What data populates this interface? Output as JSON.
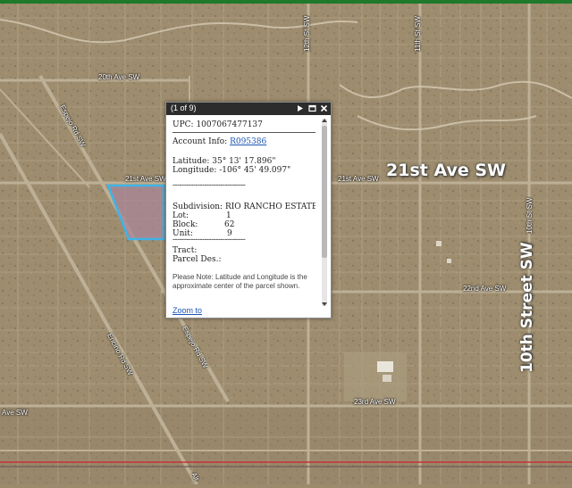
{
  "map": {
    "streets": {
      "ave_20th": "20th Ave SW",
      "ave_21st_small": "21st Ave SW",
      "ave_21st_large": "21st Ave SW",
      "ave_22nd": "22nd Ave SW",
      "ave_23rd": "23rd Ave SW",
      "ave_left": "Ave SW",
      "st_12th": "12th St SW",
      "st_11th": "11th St SW",
      "st_10th_small": "10th St SW",
      "st_10th_large": "10th Street SW",
      "espejo_top": "Espejo Rd SW",
      "espejo_bottom": "Espejo Rd SW",
      "encino": "Encino Rd SW",
      "alt": "Alt"
    },
    "colors": {
      "parcel_outline": "#3fb3e8",
      "parcel_fill": "#a9869a",
      "top_strip": "#1e7a2a",
      "bottom_line_red": "#c7303a"
    }
  },
  "popup": {
    "count": "(1 of 9)",
    "upc_label": "UPC:",
    "upc_value": "1007067477137",
    "account_label": "Account Info:",
    "account_value": "R095386",
    "latitude_label": "Latitude:",
    "latitude_value": "35° 13' 17.896\"",
    "longitude_label": "Longitude:",
    "longitude_value": "-106° 45' 49.097\"",
    "dashes": "--------------------------------",
    "subdivision_label": "Subdivision:",
    "subdivision_value": "RIO RANCHO ESTATES",
    "lot_label": "Lot:",
    "lot_value": "1",
    "block_label": "Block:",
    "block_value": "62",
    "unit_label": "Unit:",
    "unit_value": "9",
    "tract_label": "Tract:",
    "parcel_des_label": "Parcel Des.:",
    "note": "Please Note: Latitude and Longitude is the approximate center of the parcel shown.",
    "zoom_label": "Zoom to",
    "icons": {
      "next": "play-triangle-icon",
      "maximize": "maximize-icon",
      "close": "close-x-icon"
    }
  }
}
